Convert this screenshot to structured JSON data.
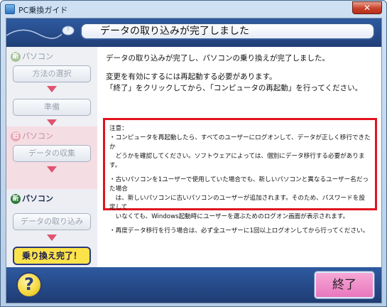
{
  "window": {
    "title": "PC乗換ガイド",
    "close_label": "✕"
  },
  "header": {
    "title": "データの取り込みが完了しました"
  },
  "sidebar": {
    "sections": [
      {
        "badge": "新",
        "label": "パソコン",
        "badge_color": "#a9c29a"
      },
      {
        "badge": "旧",
        "label": "パソコン",
        "badge_color": "#e8a7b4"
      },
      {
        "badge": "新",
        "label": "パソコン",
        "badge_color": "#2e7a3a"
      }
    ],
    "steps": [
      "方法の選択",
      "準備",
      "データの収集",
      "データの取り込み"
    ],
    "final_button": "乗り換え完了！"
  },
  "content": {
    "line1": "データの取り込みが完了し、パソコンの乗り換えが完了しました。",
    "line2": "変更を有効にするには再起動する必要があります。",
    "line3": "「終了」をクリックしてから、「コンピュータの再起動」を行ってください。",
    "notice": {
      "title": "注意：",
      "item1": "・コンピュータを再起動したら、すべてのユーザーにログオンして、データが正しく移行できたか\n　どうかを確認してください。ソフトウェアによっては、個別にデータ移行する必要があります。",
      "item2": "・古いパソコンを1ユーザーで使用していた場合でも、新しいパソコンと異なるユーザー名だった場合\n　は、新しいパソコンに古いパソコンのユーザーが追加されます。そのため、パスワードを設定して\n　いなくても、Windows起動時にユーザーを選ぶためのログオン画面が表示されます。",
      "item3": "・再度データ移行を行う場合は、必ず全ユーザーに1回以上ログオンしてから行ってください。"
    }
  },
  "footer": {
    "help_label": "?",
    "finish_label": "終了"
  }
}
